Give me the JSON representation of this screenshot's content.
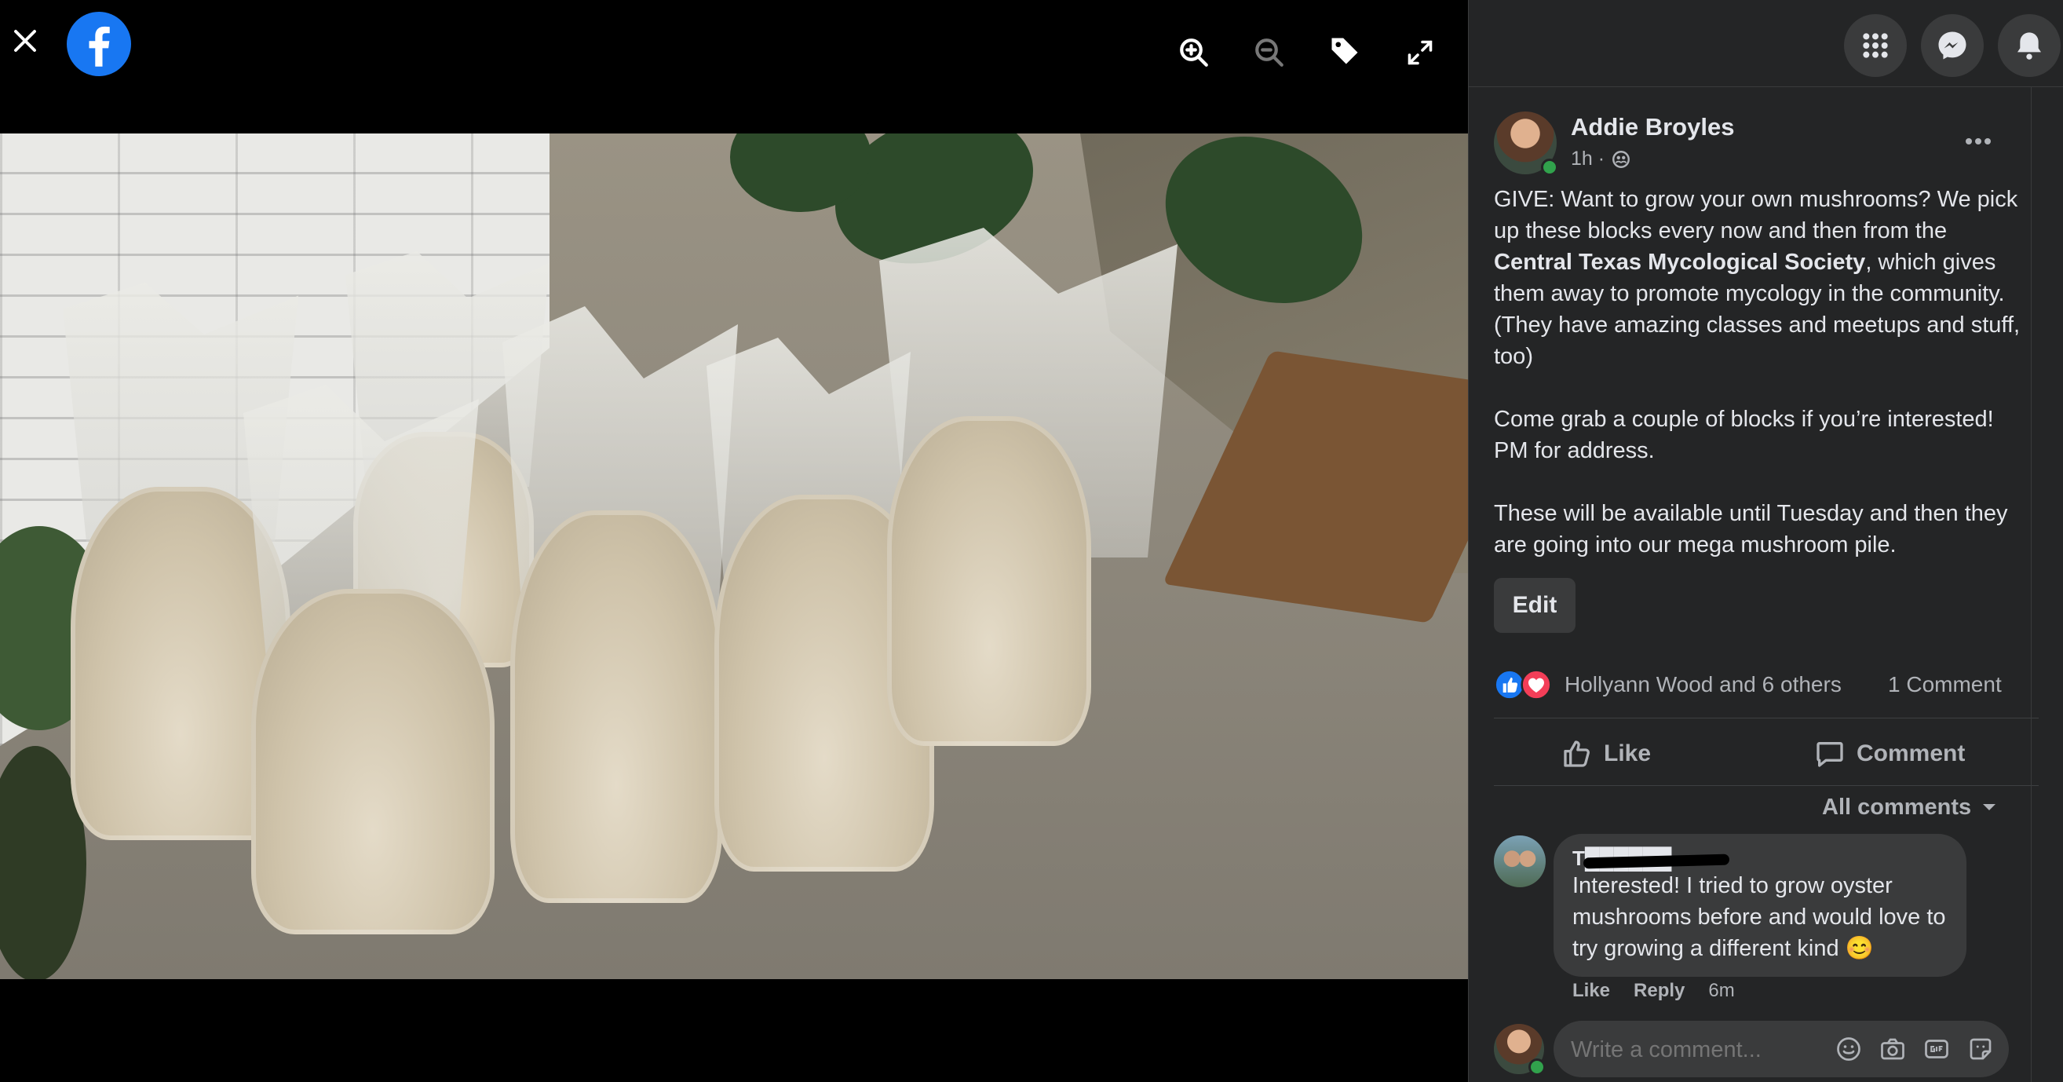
{
  "viewer": {
    "close_icon": "close-icon",
    "logo_icon": "facebook-logo-icon",
    "toolbar": [
      "zoom-in-icon",
      "zoom-out-icon",
      "tag-icon",
      "fullscreen-icon"
    ],
    "photo_alt": "Bags of mushroom grow blocks on a porch"
  },
  "header": {
    "menu_icon": "menu-grid-icon",
    "messenger_icon": "messenger-icon",
    "notifications_icon": "bell-icon"
  },
  "post": {
    "author": "Addie Broyles",
    "time": "1h ·",
    "privacy_icon": "friends-icon",
    "more_icon": "more-icon",
    "text_part1": "GIVE: Want to grow your own mushrooms? We pick up these blocks every now and then from the ",
    "text_bold": "Central Texas Mycological Society",
    "text_part2": ", which gives them away to promote mycology in the community. (They have amazing classes and meetups and stuff, too)",
    "paragraph2": "Come grab a couple of blocks if you’re interested! PM for address.",
    "paragraph3": "These will be available until Tuesday and then they are going into our mega mushroom pile.",
    "edit_label": "Edit"
  },
  "reactions": {
    "summary": "Hollyann Wood and 6 others",
    "comments_count": "1 Comment",
    "like_color": "#1877f2",
    "love_color": "#f33e58"
  },
  "actions": {
    "like": "Like",
    "comment": "Comment"
  },
  "comments": {
    "filter": "All comments",
    "items": [
      {
        "author": "T██████",
        "text": "Interested! I tried to grow oyster mushrooms before and would love to try growing a different kind 😊",
        "like": "Like",
        "reply": "Reply",
        "time": "6m"
      }
    ],
    "input_placeholder": "Write a comment..."
  },
  "colors": {
    "panel_bg": "#242526",
    "text": "#e4e6eb",
    "muted": "#b0b3b8",
    "accent": "#1877f2"
  }
}
